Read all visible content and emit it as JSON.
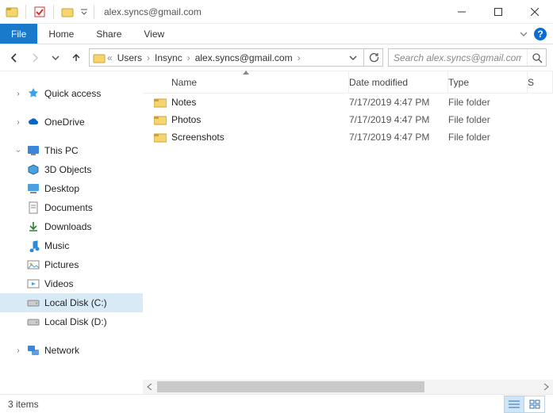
{
  "title": "alex.syncs@gmail.com",
  "ribbon": {
    "file": "File",
    "home": "Home",
    "share": "Share",
    "view": "View"
  },
  "breadcrumb": {
    "seg1": "Users",
    "seg2": "Insync",
    "seg3": "alex.syncs@gmail.com"
  },
  "search": {
    "placeholder": "Search alex.syncs@gmail.com"
  },
  "nav": {
    "quick": "Quick access",
    "onedrive": "OneDrive",
    "thispc": "This PC",
    "objects3d": "3D Objects",
    "desktop": "Desktop",
    "documents": "Documents",
    "downloads": "Downloads",
    "music": "Music",
    "pictures": "Pictures",
    "videos": "Videos",
    "diskC": "Local Disk (C:)",
    "diskD": "Local Disk (D:)",
    "network": "Network"
  },
  "columns": {
    "name": "Name",
    "date": "Date modified",
    "type": "Type",
    "size": "S"
  },
  "rows": [
    {
      "name": "Notes",
      "date": "7/17/2019 4:47 PM",
      "type": "File folder"
    },
    {
      "name": "Photos",
      "date": "7/17/2019 4:47 PM",
      "type": "File folder"
    },
    {
      "name": "Screenshots",
      "date": "7/17/2019 4:47 PM",
      "type": "File folder"
    }
  ],
  "status": {
    "text": "3 items"
  }
}
